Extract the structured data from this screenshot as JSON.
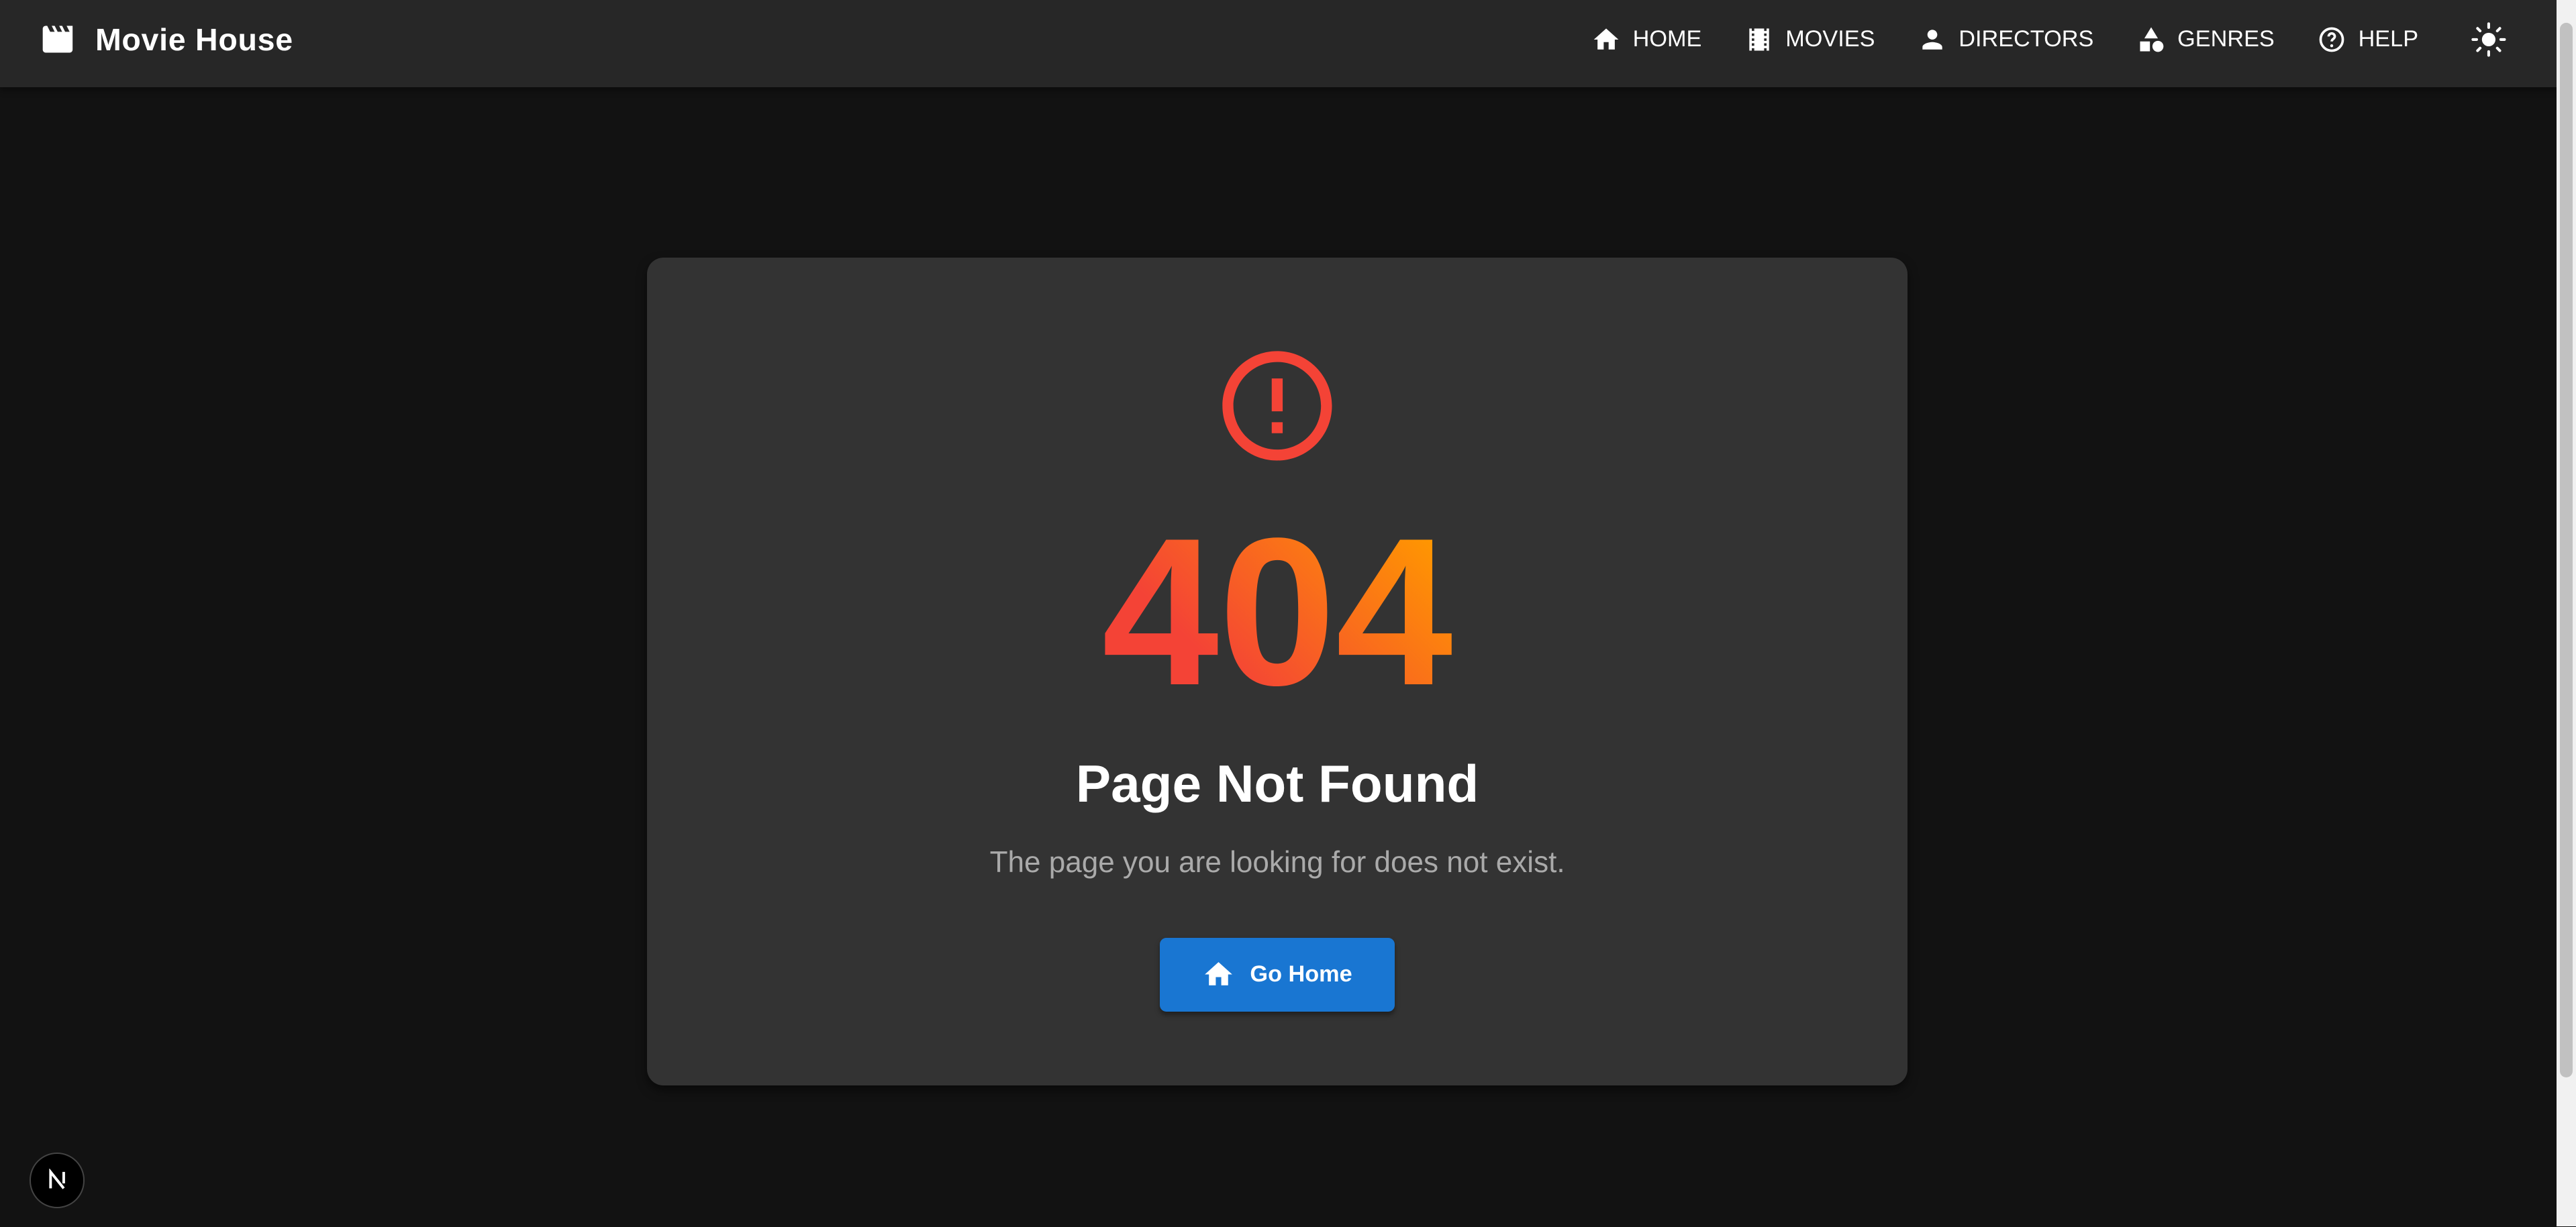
{
  "header": {
    "title": "Movie House",
    "nav": [
      {
        "label": "HOME",
        "icon": "home-icon"
      },
      {
        "label": "MOVIES",
        "icon": "film-icon"
      },
      {
        "label": "DIRECTORS",
        "icon": "person-icon"
      },
      {
        "label": "GENRES",
        "icon": "category-icon"
      },
      {
        "label": "HELP",
        "icon": "help-icon"
      }
    ],
    "theme_toggle": "sun-icon"
  },
  "error": {
    "code": "404",
    "title": "Page Not Found",
    "message": "The page you are looking for does not exist.",
    "button_label": "Go Home",
    "icon": "error-outline-icon"
  },
  "colors": {
    "accent": "#1976d2",
    "error": "#f44336",
    "gradient_end": "#ff9800"
  }
}
